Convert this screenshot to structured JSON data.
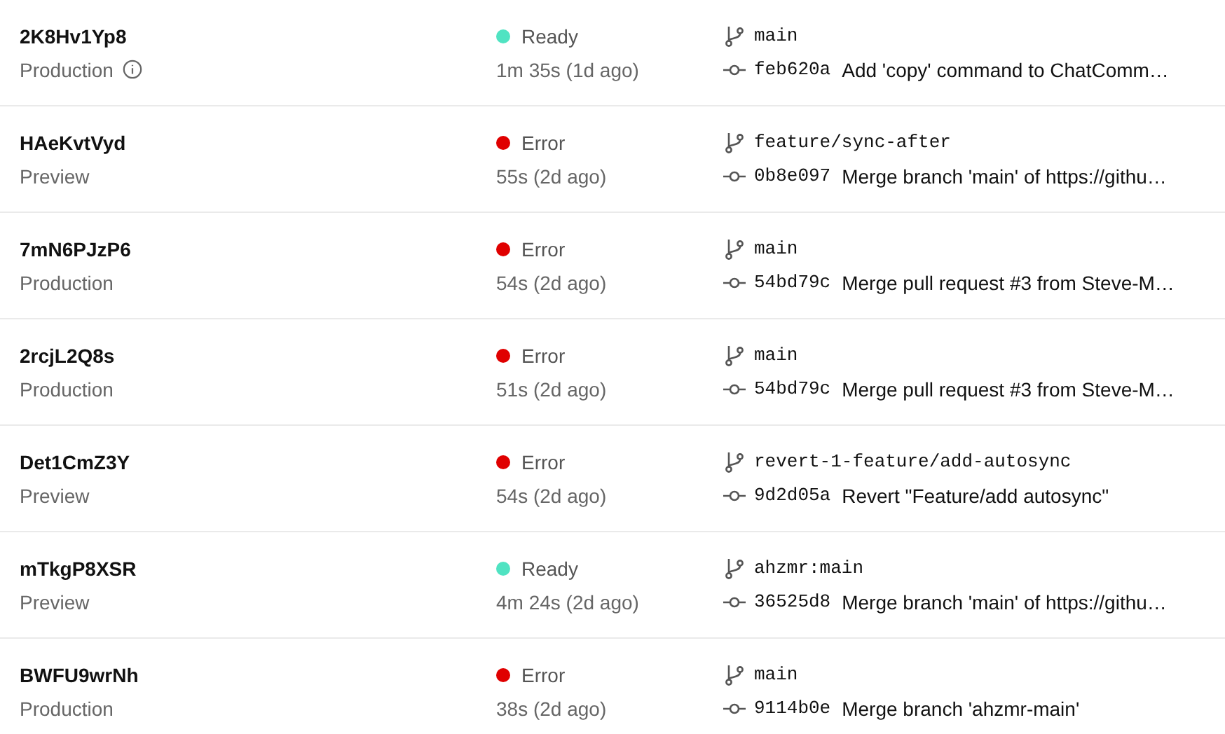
{
  "deployments": [
    {
      "id": "2K8Hv1Yp8",
      "environment": "Production",
      "info": true,
      "status": "Ready",
      "color": "#50e3c2",
      "duration": "1m 35s (1d ago)",
      "branch": "main",
      "commit": "feb620a",
      "message": "Add 'copy' command to ChatComm…"
    },
    {
      "id": "HAeKvtVyd",
      "environment": "Preview",
      "info": false,
      "status": "Error",
      "color": "#e00000",
      "duration": "55s (2d ago)",
      "branch": "feature/sync-after",
      "commit": "0b8e097",
      "message": "Merge branch 'main' of https://githu…"
    },
    {
      "id": "7mN6PJzP6",
      "environment": "Production",
      "info": false,
      "status": "Error",
      "color": "#e00000",
      "duration": "54s (2d ago)",
      "branch": "main",
      "commit": "54bd79c",
      "message": "Merge pull request #3 from Steve-M…"
    },
    {
      "id": "2rcjL2Q8s",
      "environment": "Production",
      "info": false,
      "status": "Error",
      "color": "#e00000",
      "duration": "51s (2d ago)",
      "branch": "main",
      "commit": "54bd79c",
      "message": "Merge pull request #3 from Steve-M…"
    },
    {
      "id": "Det1CmZ3Y",
      "environment": "Preview",
      "info": false,
      "status": "Error",
      "color": "#e00000",
      "duration": "54s (2d ago)",
      "branch": "revert-1-feature/add-autosync",
      "commit": "9d2d05a",
      "message": "Revert \"Feature/add autosync\""
    },
    {
      "id": "mTkgP8XSR",
      "environment": "Preview",
      "info": false,
      "status": "Ready",
      "color": "#50e3c2",
      "duration": "4m 24s (2d ago)",
      "branch": "ahzmr:main",
      "commit": "36525d8",
      "message": "Merge branch 'main' of https://githu…"
    },
    {
      "id": "BWFU9wrNh",
      "environment": "Production",
      "info": false,
      "status": "Error",
      "color": "#e00000",
      "duration": "38s (2d ago)",
      "branch": "main",
      "commit": "9114b0e",
      "message": "Merge branch 'ahzmr-main'"
    }
  ]
}
